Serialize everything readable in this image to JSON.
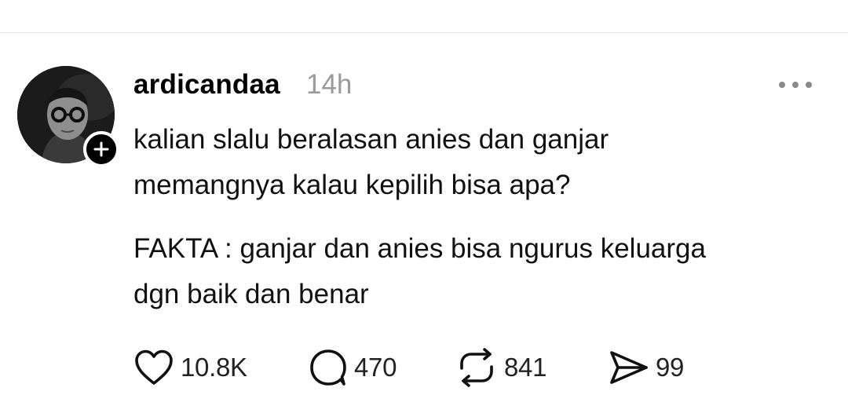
{
  "post": {
    "username": "ardicandaa",
    "timestamp": "14h",
    "paragraphs": [
      {
        "lines": [
          "kalian slalu beralasan anies dan ganjar",
          "memangnya kalau kepilih bisa apa?"
        ]
      },
      {
        "lines": [
          "FAKTA : ganjar dan anies bisa ngurus keluarga",
          "dgn baik dan benar"
        ]
      }
    ]
  },
  "actions": {
    "like_count": "10.8K",
    "reply_count": "470",
    "repost_count": "841",
    "share_count": "99"
  },
  "icons": {
    "avatar": "profile-photo",
    "follow": "plus-icon",
    "more": "more-dots-icon",
    "like": "heart-icon",
    "reply": "comment-bubble-icon",
    "repost": "repost-icon",
    "share": "send-icon"
  },
  "colors": {
    "text": "#000000",
    "muted": "#9a9a9a",
    "divider": "#e6e6e6",
    "badge": "#000000"
  }
}
